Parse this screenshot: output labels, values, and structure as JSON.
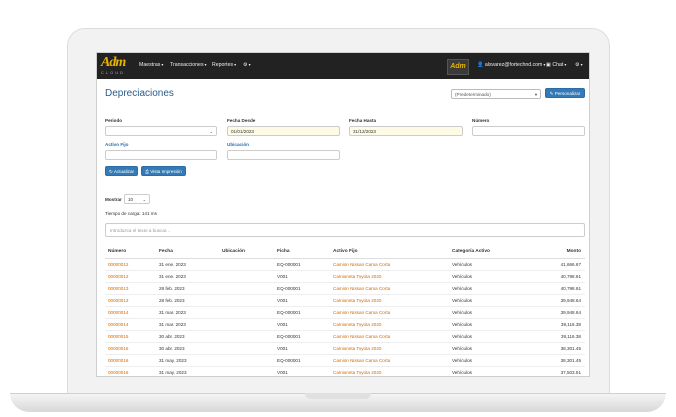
{
  "nav": {
    "items": [
      {
        "label": "Maestras"
      },
      {
        "label": "Transacciones"
      },
      {
        "label": "Reportes"
      }
    ],
    "user": "alsvarez@fortechnd.com",
    "chat": "Chat"
  },
  "page": {
    "title": "Depreciaciones",
    "view_select": "(Predeterminado)",
    "personalize_button": "Personalizar"
  },
  "filters": {
    "periodo_label": "Periodo",
    "fecha_desde_label": "Fecha Desde",
    "fecha_desde_value": "01/01/2023",
    "fecha_hasta_label": "Fecha Hasta",
    "fecha_hasta_value": "31/12/2023",
    "numero_label": "Número",
    "activo_fijo_label": "Activo Fijo",
    "ubicacion_label": "Ubicación",
    "refresh_button": "Actualizar",
    "print_button": "Vista Impresión"
  },
  "list": {
    "show_label": "Mostrar",
    "show_value": "10",
    "load_time": "Tiempo de carga: 141 ms",
    "search_placeholder": "Introduzca el texto a buscar..."
  },
  "table": {
    "headers": [
      "Número",
      "Fecha",
      "Ubicación",
      "Ficha",
      "Activo Fijo",
      "Categoría Activo",
      "Monto"
    ],
    "rows": [
      {
        "numero": "00000012",
        "fecha": "31 ene. 2023",
        "ubicacion": "",
        "ficha": "EQ-000001",
        "activo": "Camion Nissan Cama Corta",
        "categoria": "Vehículos",
        "monto": "41,666.67"
      },
      {
        "numero": "00000012",
        "fecha": "31 ene. 2023",
        "ubicacion": "",
        "ficha": "V001",
        "activo": "Camioneta Toyota 2020",
        "categoria": "Vehículos",
        "monto": "40,798.61"
      },
      {
        "numero": "00000013",
        "fecha": "28 feb. 2023",
        "ubicacion": "",
        "ficha": "EQ-000001",
        "activo": "Camion Nissan Cama Corta",
        "categoria": "Vehículos",
        "monto": "40,798.61"
      },
      {
        "numero": "00000013",
        "fecha": "28 feb. 2023",
        "ubicacion": "",
        "ficha": "V001",
        "activo": "Camioneta Toyota 2020",
        "categoria": "Vehículos",
        "monto": "39,948.64"
      },
      {
        "numero": "00000014",
        "fecha": "31 mar. 2023",
        "ubicacion": "",
        "ficha": "EQ-000001",
        "activo": "Camion Nissan Cama Corta",
        "categoria": "Vehículos",
        "monto": "39,948.64"
      },
      {
        "numero": "00000014",
        "fecha": "31 mar. 2023",
        "ubicacion": "",
        "ficha": "V001",
        "activo": "Camioneta Toyota 2020",
        "categoria": "Vehículos",
        "monto": "39,116.38"
      },
      {
        "numero": "00000015",
        "fecha": "30 abr. 2023",
        "ubicacion": "",
        "ficha": "EQ-000001",
        "activo": "Camion Nissan Cama Corta",
        "categoria": "Vehículos",
        "monto": "39,116.38"
      },
      {
        "numero": "00000015",
        "fecha": "30 abr. 2023",
        "ubicacion": "",
        "ficha": "V001",
        "activo": "Camioneta Toyota 2020",
        "categoria": "Vehículos",
        "monto": "38,301.45"
      },
      {
        "numero": "00000016",
        "fecha": "31 may. 2023",
        "ubicacion": "",
        "ficha": "EQ-000001",
        "activo": "Camion Nissan Cama Corta",
        "categoria": "Vehículos",
        "monto": "38,301.45"
      },
      {
        "numero": "00000016",
        "fecha": "31 may. 2023",
        "ubicacion": "",
        "ficha": "V001",
        "activo": "Camioneta Toyota 2020",
        "categoria": "Vehículos",
        "monto": "37,503.51"
      }
    ]
  },
  "colors": {
    "accent": "#337ab7",
    "link": "#d46a00",
    "navbar": "#222222"
  }
}
